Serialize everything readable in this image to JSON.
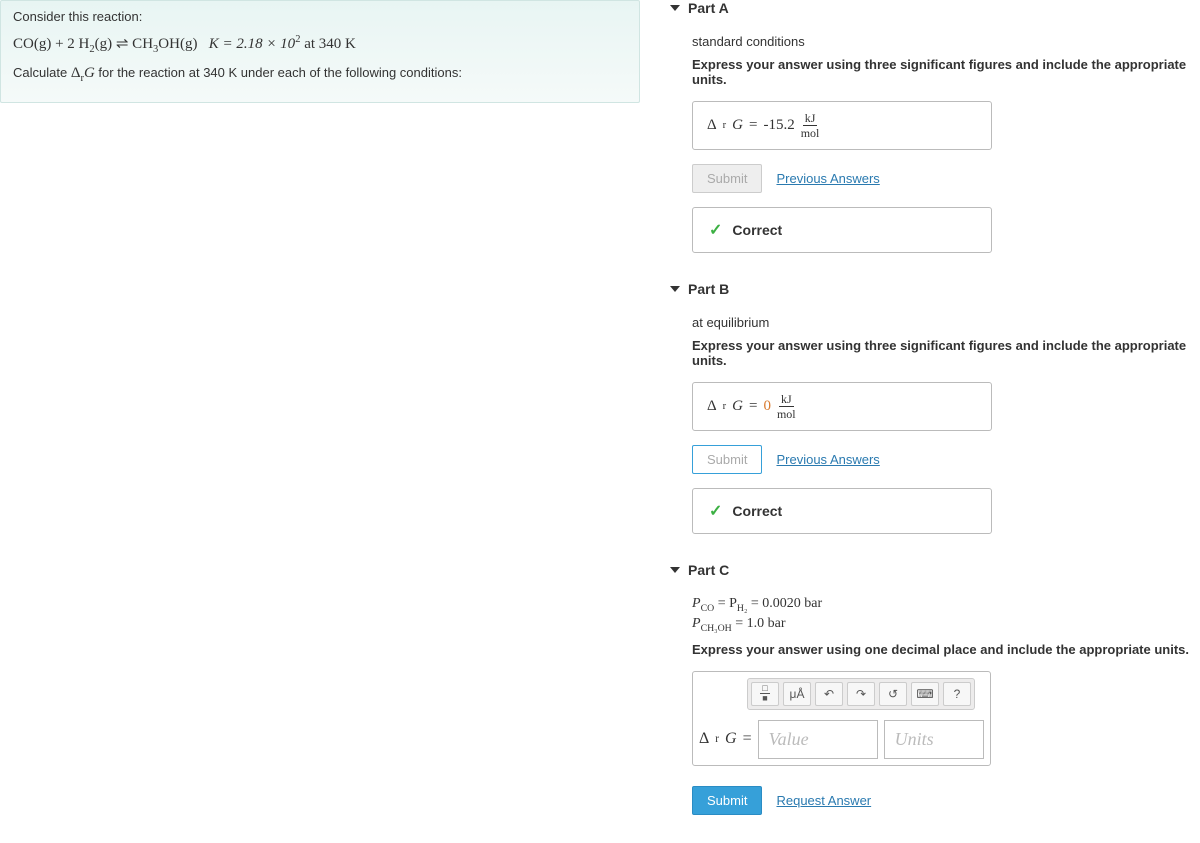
{
  "question": {
    "intro": "Consider this reaction:",
    "equation_lhs1": "CO(g) + 2 H",
    "equation_sub1": "2",
    "equation_mid": "(g) ⇌ CH",
    "equation_sub2": "3",
    "equation_rhs": "OH(g)",
    "k_label": "K = 2.18 × 10",
    "k_exp": "2",
    "k_suffix": " at 340 K",
    "calc_prefix": "Calculate ",
    "drg_sym": "Δ",
    "drg_sub": "r",
    "drg_g": "G",
    "calc_suffix": " for the reaction at 340 K under each of the following conditions:"
  },
  "partA": {
    "title": "Part A",
    "condition": "standard conditions",
    "instruction": "Express your answer using three significant figures and include the appropriate units.",
    "symbol_pre": "Δ",
    "symbol_sub": "r",
    "symbol_g": "G",
    "eq": "=",
    "value": "-15.2",
    "unit_num": "kJ",
    "unit_den": "mol",
    "submit": "Submit",
    "prev": "Previous Answers",
    "correct": "Correct"
  },
  "partB": {
    "title": "Part B",
    "condition": "at equilibrium",
    "instruction": "Express your answer using three significant figures and include the appropriate units.",
    "symbol_pre": "Δ",
    "symbol_sub": "r",
    "symbol_g": "G",
    "eq": "=",
    "value": "0",
    "unit_num": "kJ",
    "unit_den": "mol",
    "submit": "Submit",
    "prev": "Previous Answers",
    "correct": "Correct"
  },
  "partC": {
    "title": "Part C",
    "line1_p": "P",
    "line1_sub1": "CO",
    "line1_mid": " = P",
    "line1_sub2": "H₂",
    "line1_end": " = 0.0020 bar",
    "line2_p": "P",
    "line2_sub": "CH₃OH",
    "line2_end": " = 1.0 bar",
    "instruction": "Express your answer using one decimal place and include the appropriate units.",
    "tool_units": "μÅ",
    "tool_undo": "↶",
    "tool_redo": "↷",
    "tool_reset": "↺",
    "tool_kbd": "⌨",
    "tool_help": "?",
    "symbol_pre": "Δ",
    "symbol_sub": "r",
    "symbol_g": "G",
    "eq": "=",
    "value_ph": "Value",
    "units_ph": "Units",
    "submit": "Submit",
    "request": "Request Answer"
  }
}
